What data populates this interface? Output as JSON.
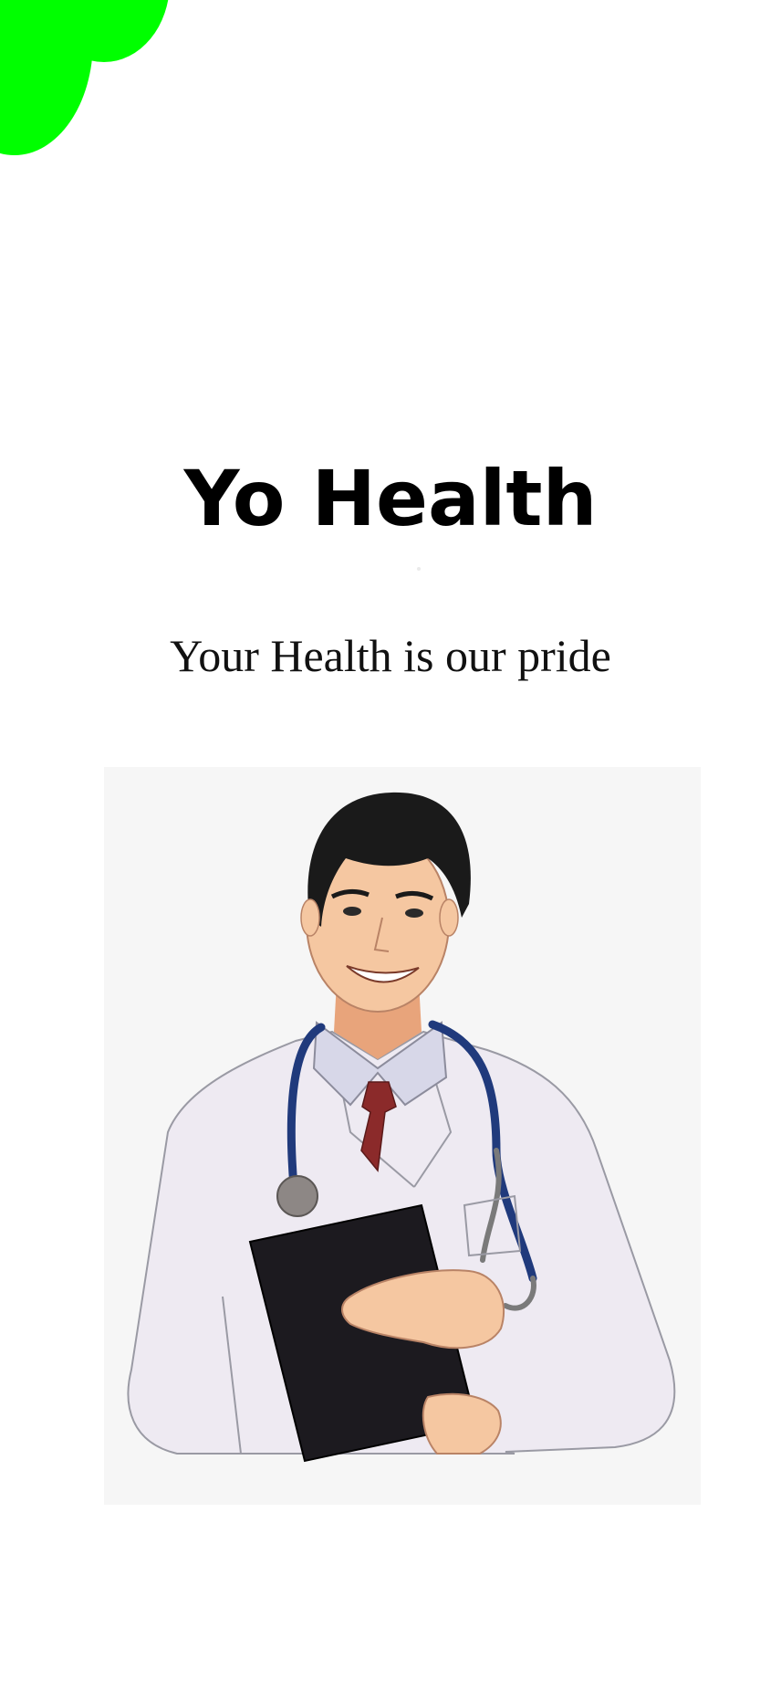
{
  "brand": {
    "title": "Yo Health",
    "tagline": "Your Health is our pride"
  },
  "illustration": {
    "subject": "doctor with stethoscope holding clipboard"
  },
  "colors": {
    "accent": "#00ff00",
    "background": "#ffffff",
    "illustration_bg": "#f6f6f6",
    "coat": "#eeeaf2",
    "skin": "#f5c7a1",
    "hair": "#1a1a1a",
    "tie": "#8b2a2a",
    "shirt": "#d7d7e8",
    "stethoscope": "#203a7c",
    "clipboard": "#1c1a1f"
  }
}
